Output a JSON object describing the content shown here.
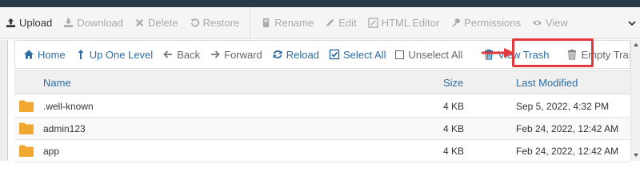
{
  "toolbar": {
    "items": [
      {
        "label": "Upload",
        "icon": "upload-icon",
        "enabled": true
      },
      {
        "label": "Download",
        "icon": "download-icon",
        "enabled": false
      },
      {
        "label": "Delete",
        "icon": "close-icon",
        "enabled": false
      },
      {
        "label": "Restore",
        "icon": "restore-icon",
        "enabled": false
      },
      {
        "label": "Rename",
        "icon": "rename-icon",
        "enabled": false
      },
      {
        "label": "Edit",
        "icon": "pencil-icon",
        "enabled": false
      },
      {
        "label": "HTML Editor",
        "icon": "html-editor-icon",
        "enabled": false
      },
      {
        "label": "Permissions",
        "icon": "key-icon",
        "enabled": false
      },
      {
        "label": "View",
        "icon": "eye-icon",
        "enabled": false
      }
    ]
  },
  "navbar": {
    "home": "Home",
    "up_one_level": "Up One Level",
    "back": "Back",
    "forward": "Forward",
    "reload": "Reload",
    "select_all": "Select All",
    "unselect_all": "Unselect All",
    "view_trash": "View Trash",
    "empty_trash": "Empty Trash"
  },
  "table": {
    "columns": {
      "name": "Name",
      "size": "Size",
      "modified": "Last Modified"
    },
    "rows": [
      {
        "name": ".well-known",
        "size": "4 KB",
        "modified": "Sep 5, 2022, 4:32 PM"
      },
      {
        "name": "admin123",
        "size": "4 KB",
        "modified": "Feb 24, 2022, 12:42 AM"
      },
      {
        "name": "app",
        "size": "4 KB",
        "modified": "Feb 24, 2022, 12:42 AM"
      }
    ]
  },
  "colors": {
    "link": "#2d6ca2",
    "highlight": "#e03a3e",
    "folder": "#f0a830",
    "top_bar": "#293a4a"
  }
}
